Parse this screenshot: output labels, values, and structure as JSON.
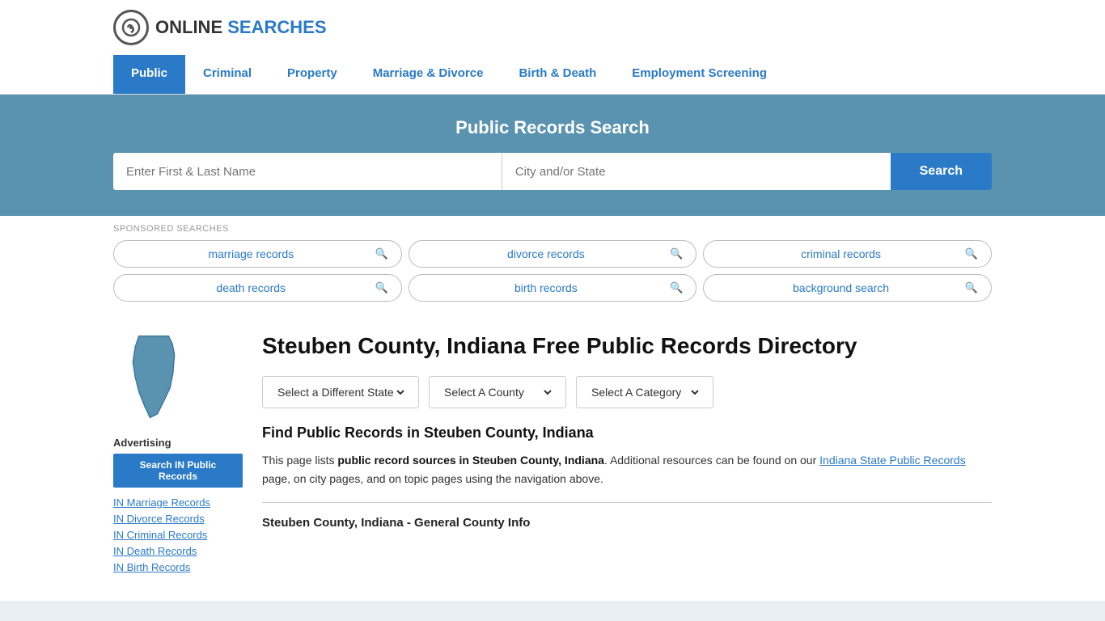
{
  "logo": {
    "text_online": "ONLINE",
    "text_searches": "SEARCHES"
  },
  "nav": {
    "items": [
      {
        "label": "Public",
        "active": true
      },
      {
        "label": "Criminal",
        "active": false
      },
      {
        "label": "Property",
        "active": false
      },
      {
        "label": "Marriage & Divorce",
        "active": false
      },
      {
        "label": "Birth & Death",
        "active": false
      },
      {
        "label": "Employment Screening",
        "active": false
      }
    ]
  },
  "hero": {
    "title": "Public Records Search",
    "name_placeholder": "Enter First & Last Name",
    "location_placeholder": "City and/or State",
    "search_label": "Search"
  },
  "sponsored": {
    "label": "SPONSORED SEARCHES",
    "items": [
      {
        "text": "marriage records"
      },
      {
        "text": "divorce records"
      },
      {
        "text": "criminal records"
      },
      {
        "text": "death records"
      },
      {
        "text": "birth records"
      },
      {
        "text": "background search"
      }
    ]
  },
  "sidebar": {
    "advertising_label": "Advertising",
    "ad_button_label": "Search IN Public Records",
    "links": [
      {
        "text": "IN Marriage Records",
        "href": "#"
      },
      {
        "text": "IN Divorce Records",
        "href": "#"
      },
      {
        "text": "IN Criminal Records",
        "href": "#"
      },
      {
        "text": "IN Death Records",
        "href": "#"
      },
      {
        "text": "IN Birth Records",
        "href": "#"
      }
    ]
  },
  "content": {
    "page_title": "Steuben County, Indiana Free Public Records Directory",
    "dropdown_state": "Select a Different State",
    "dropdown_county": "Select A County",
    "dropdown_category": "Select A Category",
    "find_title": "Find Public Records in Steuben County, Indiana",
    "description_part1": "This page lists ",
    "description_bold": "public record sources in Steuben County, Indiana",
    "description_part2": ". Additional resources can be found on our ",
    "description_link": "Indiana State Public Records",
    "description_part3": " page, on city pages, and on topic pages using the navigation above.",
    "section_subtitle": "Steuben County, Indiana - General County Info"
  }
}
